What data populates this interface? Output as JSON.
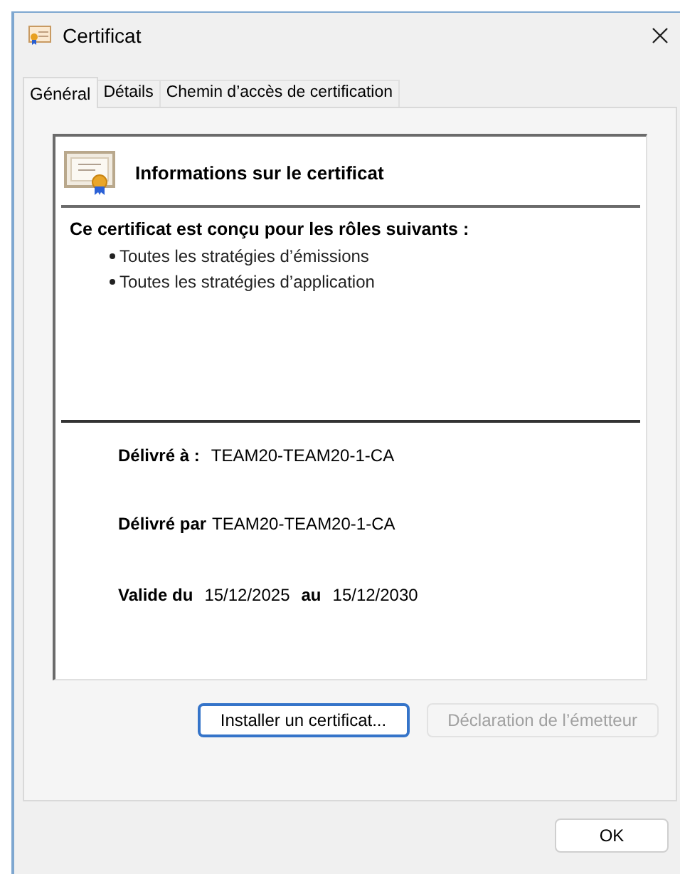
{
  "window": {
    "title": "Certificat"
  },
  "tabs": [
    {
      "label": "Général",
      "selected": true
    },
    {
      "label": "Détails",
      "selected": false
    },
    {
      "label": "Chemin d’accès de certification",
      "selected": false
    }
  ],
  "info": {
    "heading": "Informations sur le certificat",
    "purpose_title": "Ce certificat est conçu pour les rôles suivants :",
    "purposes": [
      "Toutes les stratégies d’émissions",
      "Toutes les stratégies d’application"
    ],
    "issued_to": {
      "label": "Délivré à :",
      "value": "TEAM20-TEAM20-1-CA"
    },
    "issued_by": {
      "label": "Délivré par",
      "value": "TEAM20-TEAM20-1-CA"
    },
    "validity": {
      "label": "Valide du",
      "from": "15/12/2025",
      "to_label": "au",
      "to": "15/12/2030"
    }
  },
  "panel_buttons": [
    {
      "label": "Installer un certificat...",
      "disabled": false,
      "focused": true
    },
    {
      "label": "Déclaration de l’émetteur",
      "disabled": true,
      "focused": false
    }
  ],
  "footer_buttons": [
    {
      "label": "OK",
      "disabled": false,
      "focused": false
    }
  ]
}
